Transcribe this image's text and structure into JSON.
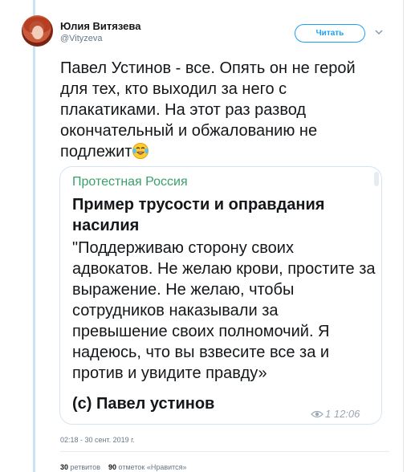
{
  "tweet": {
    "author_name": "Юлия Витязева",
    "author_handle": "@Vityzeva",
    "follow_label": "Читать",
    "chevron_icon": "chevron-down-icon",
    "text": "Павел Устинов - все. Опять он не герой для тех, кто выходил за него с плакатиками. На этот раз развод окончательный и обжалованию не подлежит",
    "emoji": "face-with-tears-of-joy",
    "timestamp": "02:18 - 30 сент. 2019 г."
  },
  "embedded_post": {
    "channel": "Протестная Россия",
    "title": "Пример трусости и оправдания насилия",
    "body": "\"Поддерживаю сторону своих адвокатов. Не желаю крови, простите за выражение. Не желаю, чтобы сотрудников наказывали за превышение своих полномочий. Я надеюсь, что вы взвесите все за и против и увидите правду»",
    "signature": "(с) Павел устинов",
    "views": "1 12:06"
  },
  "stats": {
    "retweets_count": "30",
    "retweets_label": "ретвитов",
    "likes_count": "90",
    "likes_label": "отметок «Нравится»"
  },
  "colors": {
    "accent": "#1da1f2",
    "channel_green": "#3aa06a",
    "rail": "#c8e4f6"
  }
}
